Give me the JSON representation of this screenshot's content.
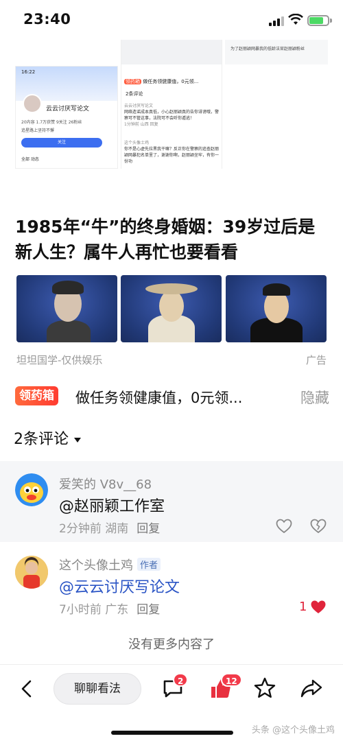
{
  "status": {
    "time": "23:40"
  },
  "post_screens": {
    "profile": {
      "time": "16:22",
      "name": "云云讨厌写论文",
      "stats": "20内容  1.7万获赞  9关注  26粉丝",
      "bio": "追星路上坚持不懈",
      "follow_label": "关注",
      "tabs": "全部  动态"
    },
    "thread": {
      "badge": "领药箱",
      "heading": "做任务领健康值，0元领...",
      "count": "2条评论",
      "c1_name": "云云讨厌写论文",
      "c1_text": "网络造谣成本真低，小心赵丽颖真的告你诽谤哦，警察可不管这事，法院可不会听你遁逃！",
      "c1_meta": "1分钟前 山西  回复",
      "c2_name": "这个头像土鸡",
      "c2_text": "你不是心虚先拉黑我干嘛？反正你在警察的追查赵丽颖网暴犯名单里了，谢谢你啊，赵丽颖坐牢，有你一份功"
    },
    "note": "为了赵丽颖网暴我的低龄法官赵丽颖粉丝"
  },
  "ad": {
    "title": "1985年“牛”的终身婚姻：39岁过后是新人生？属牛人再忙也要看看",
    "source": "坦坦国学-仅供娱乐",
    "tag": "广告"
  },
  "task": {
    "badge": "领药箱",
    "text": "做任务领健康值，0元领...",
    "hide": "隐藏"
  },
  "comments_header": "2条评论",
  "comments": [
    {
      "name": "爱笑的 V8v__68",
      "text": "@赵丽颖工作室",
      "time": "2分钟前",
      "location": "湖南",
      "reply": "回复",
      "likes": ""
    },
    {
      "name": "这个头像土鸡",
      "author_tag": "作者",
      "text": "@云云讨厌写论文",
      "time": "7小时前",
      "location": "广东",
      "reply": "回复",
      "likes": "1"
    }
  ],
  "no_more": "没有更多内容了",
  "bottom": {
    "input_label": "聊聊看法",
    "comment_badge": "2",
    "like_badge": "12",
    "watermark": "头条 @这个头像土鸡"
  },
  "colors": {
    "accent_red": "#f23a4a",
    "link_blue": "#2a54c5",
    "follow_blue": "#3c6ef0"
  }
}
